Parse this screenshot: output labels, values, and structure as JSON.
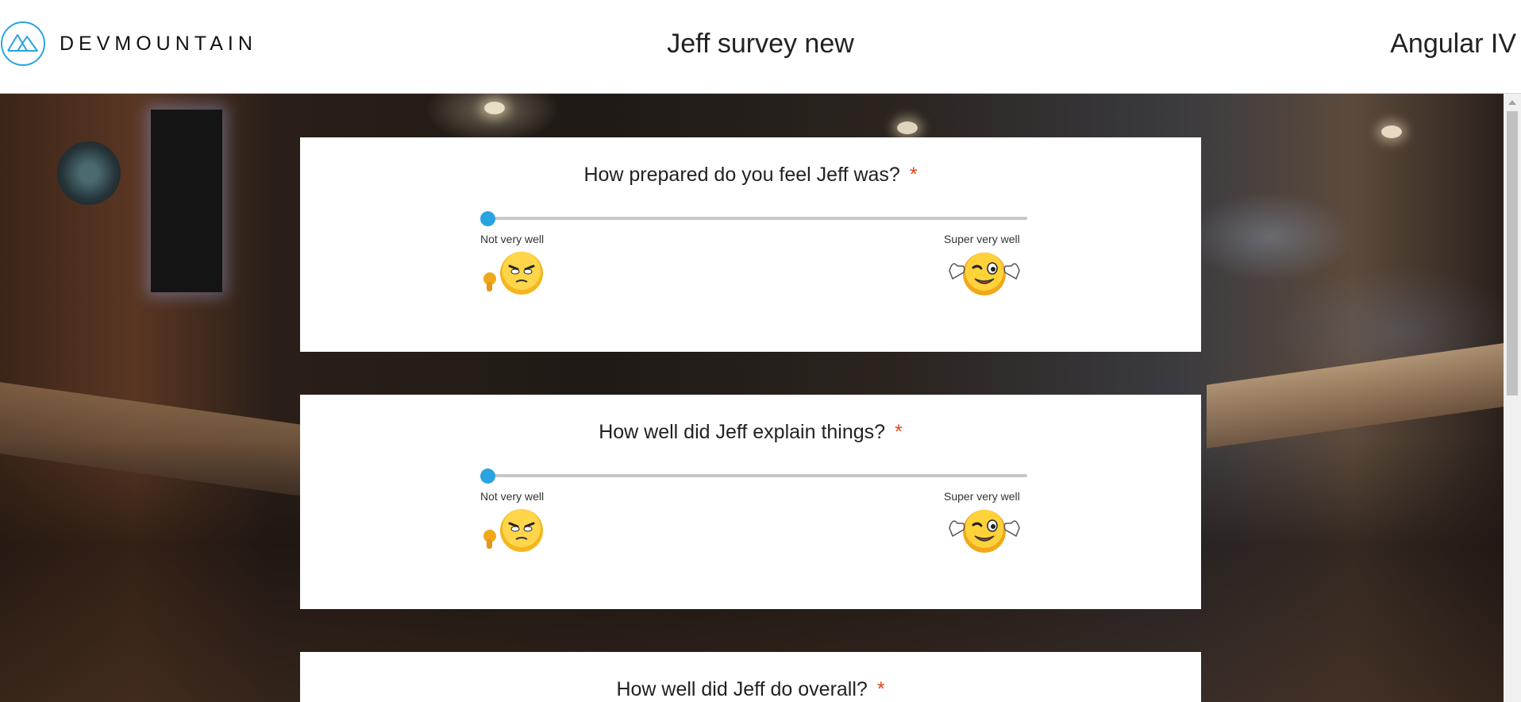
{
  "header": {
    "brand": "DEVMOUNTAIN",
    "survey_title": "Jeff survey new",
    "course": "Angular IV"
  },
  "colors": {
    "accent": "#2aa4e0",
    "required": "#e8431a",
    "logo": "#2aa4e0"
  },
  "questions": [
    {
      "text": "How prepared do you feel Jeff was?",
      "required_mark": "*",
      "min_label": "Not very well",
      "max_label": "Super very well",
      "value": 0
    },
    {
      "text": "How well did Jeff explain things?",
      "required_mark": "*",
      "min_label": "Not very well",
      "max_label": "Super very well",
      "value": 0
    },
    {
      "text": "How well did Jeff do overall?",
      "required_mark": "*"
    }
  ],
  "icons": {
    "logo": "mountain-logo-icon",
    "min_emoji": "grumpy-thumbs-down-emoji-icon",
    "max_emoji": "winking-thumbs-up-emoji-icon"
  }
}
